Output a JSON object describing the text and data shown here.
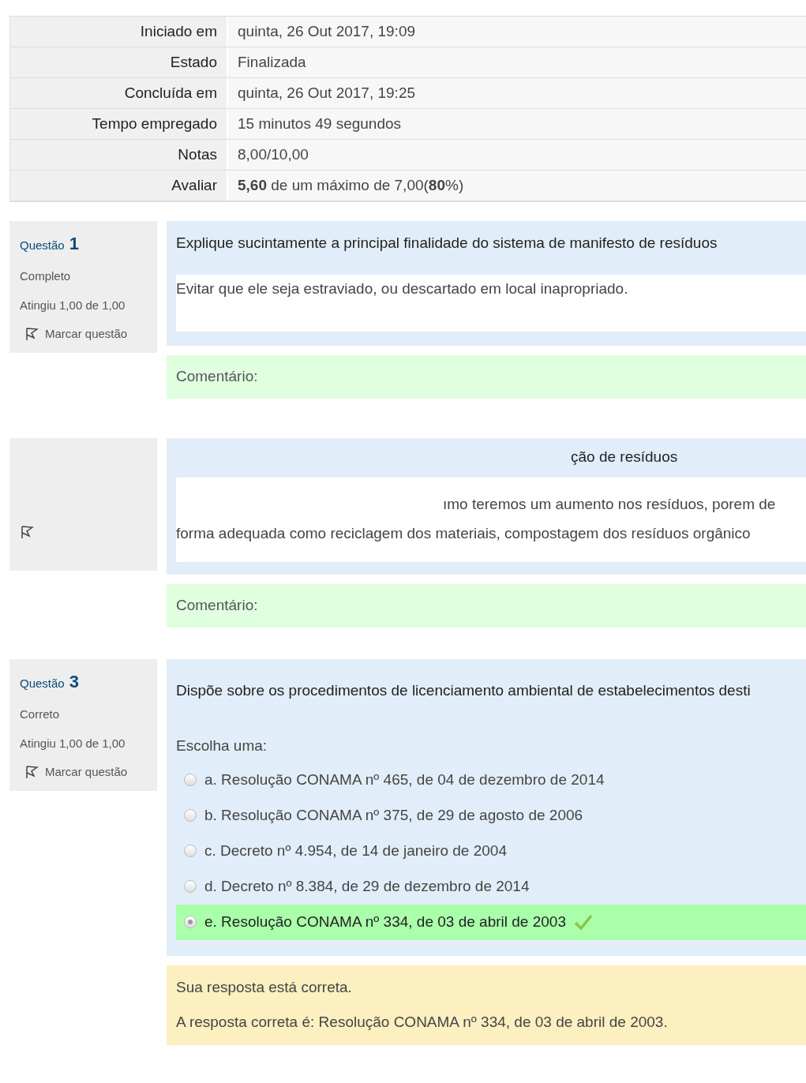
{
  "summary": [
    {
      "label": "Iniciado em",
      "value": "quinta, 26 Out 2017, 19:09"
    },
    {
      "label": "Estado",
      "value": "Finalizada"
    },
    {
      "label": "Concluída em",
      "value": "quinta, 26 Out 2017, 19:25"
    },
    {
      "label": "Tempo empregado",
      "value": "15 minutos 49 segundos"
    },
    {
      "label": "Notas",
      "value": "8,00/10,00"
    },
    {
      "label": "Avaliar",
      "value": "**5,60** de um máximo de 7,00(**80**%)"
    }
  ],
  "questions": [
    {
      "kind": "essay",
      "label": "Questão",
      "number": "1",
      "state": "Completo",
      "grade": "Atingiu 1,00 de 1,00",
      "flag": "Marcar questão",
      "text": "Explique sucintamente a principal finalidade do sistema de manifesto de resíduos",
      "answer_lines": [
        "Evitar que ele seja estraviado, ou descartado em local inapropriado."
      ],
      "comment": "Comentário:"
    },
    {
      "kind": "redacted",
      "text": "ção de resíduos",
      "answer_lines": [
        "ımo teremos um aumento nos resíduos, porem de",
        "forma adequada como reciclagem dos materiais, compostagem dos resíduos orgânico"
      ],
      "comment": "Comentário:"
    },
    {
      "kind": "choice",
      "label": "Questão",
      "number": "3",
      "state": "Correto",
      "grade": "Atingiu 1,00 de 1,00",
      "flag": "Marcar questão",
      "text": "Dispõe sobre os procedimentos de licenciamento ambiental de estabelecimentos desti",
      "prompt": "Escolha uma:",
      "options": [
        {
          "label": "a. Resolução CONAMA nº 465, de 04 de dezembro de 2014",
          "selected": false,
          "correct": false
        },
        {
          "label": "b. Resolução CONAMA nº 375, de 29 de agosto de 2006",
          "selected": false,
          "correct": false
        },
        {
          "label": "c. Decreto nº 4.954, de 14 de janeiro de 2004",
          "selected": false,
          "correct": false
        },
        {
          "label": "d. Decreto nº 8.384, de 29 de dezembro de 2014",
          "selected": false,
          "correct": false
        },
        {
          "label": "e. Resolução CONAMA nº 334, de 03 de abril de 2003",
          "selected": true,
          "correct": true
        }
      ],
      "feedback": [
        "Sua resposta está correta.",
        "A resposta correta é: Resolução CONAMA nº 334, de 03 de abril de 2003."
      ]
    }
  ]
}
